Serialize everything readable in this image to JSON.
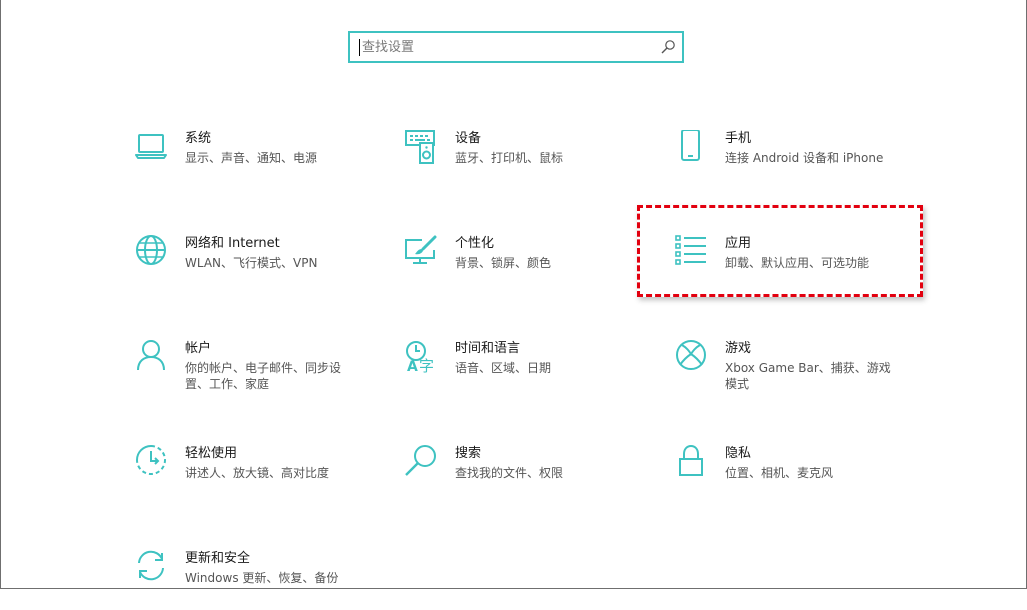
{
  "search": {
    "placeholder": "查找设置"
  },
  "colors": {
    "accent": "#3ec2c1",
    "highlight": "#e2000f"
  },
  "tiles": [
    {
      "title": "系统",
      "desc": "显示、声音、通知、电源",
      "icon": "laptop-icon"
    },
    {
      "title": "设备",
      "desc": "蓝牙、打印机、鼠标",
      "icon": "keyboard-speaker-icon"
    },
    {
      "title": "手机",
      "desc": "连接 Android 设备和 iPhone",
      "icon": "phone-icon"
    },
    {
      "title": "网络和 Internet",
      "desc": "WLAN、飞行模式、VPN",
      "icon": "globe-icon"
    },
    {
      "title": "个性化",
      "desc": "背景、锁屏、颜色",
      "icon": "paint-monitor-icon"
    },
    {
      "title": "应用",
      "desc": "卸载、默认应用、可选功能",
      "icon": "app-list-icon"
    },
    {
      "title": "帐户",
      "desc": "你的帐户、电子邮件、同步设置、工作、家庭",
      "icon": "person-icon"
    },
    {
      "title": "时间和语言",
      "desc": "语音、区域、日期",
      "icon": "time-language-icon"
    },
    {
      "title": "游戏",
      "desc": "Xbox Game Bar、捕获、游戏模式",
      "icon": "xbox-icon"
    },
    {
      "title": "轻松使用",
      "desc": "讲述人、放大镜、高对比度",
      "icon": "ease-of-access-icon"
    },
    {
      "title": "搜索",
      "desc": "查找我的文件、权限",
      "icon": "search-icon"
    },
    {
      "title": "隐私",
      "desc": "位置、相机、麦克风",
      "icon": "lock-icon"
    },
    {
      "title": "更新和安全",
      "desc": "Windows 更新、恢复、备份",
      "icon": "sync-icon"
    }
  ]
}
